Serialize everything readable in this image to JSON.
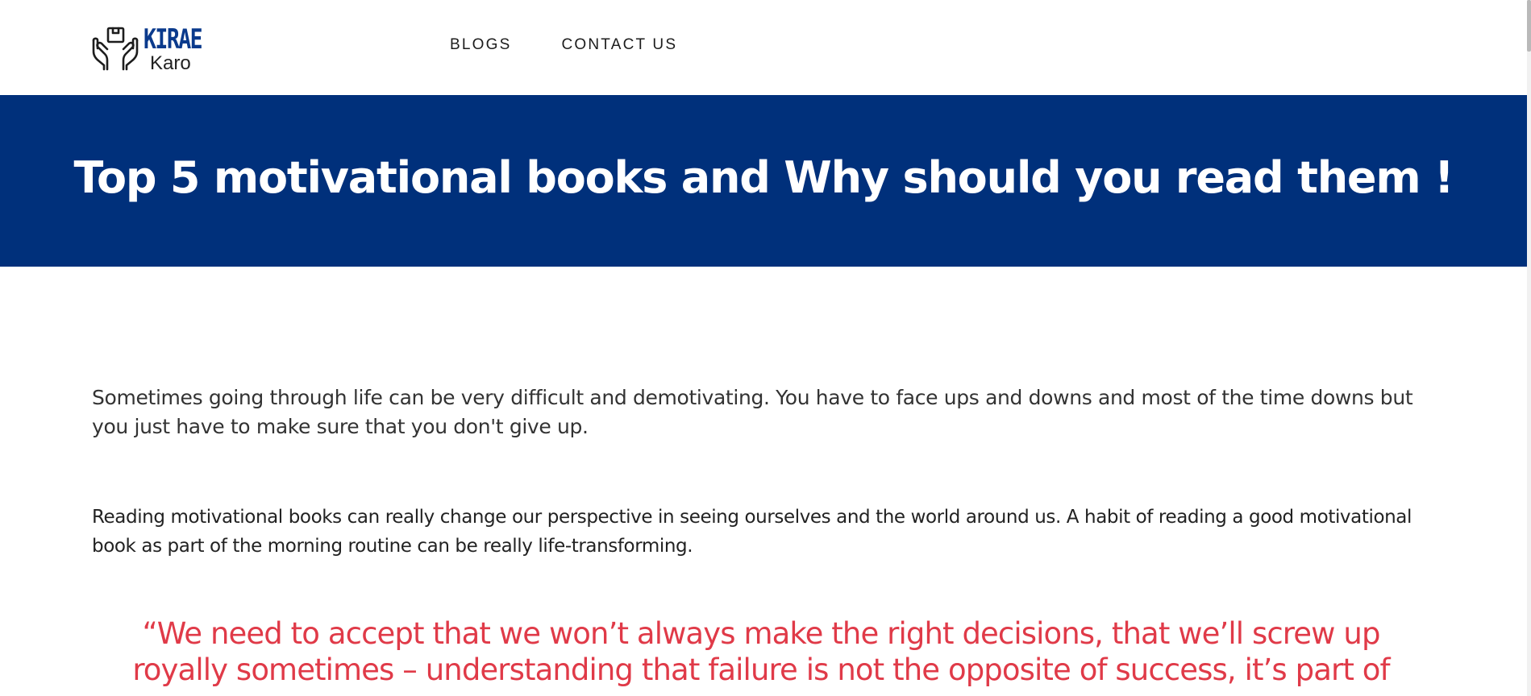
{
  "header": {
    "logo": {
      "brand": "KIRAE",
      "sub": "Karo",
      "icon": "hands-holding-box-icon"
    },
    "nav": [
      {
        "label": "BLOGS"
      },
      {
        "label": "CONTACT US"
      }
    ]
  },
  "hero": {
    "title": "Top 5 motivational books and Why should you read them !",
    "background": "#00307b"
  },
  "article": {
    "paragraphs": [
      "Sometimes going through life can be very difficult and demotivating. You have to face ups and downs and most of the time downs but you just have to make sure that you don't give up.",
      "Reading motivational books can really change our perspective in seeing ourselves and the world around us. A habit of reading a good motivational book as part of the morning routine can be really life-transforming."
    ],
    "quote": "“We need to accept that we won’t always make the right decisions, that we’ll screw up royally sometimes – understanding that failure is not the opposite of success, it’s part of",
    "quote_color": "#e03a48"
  }
}
